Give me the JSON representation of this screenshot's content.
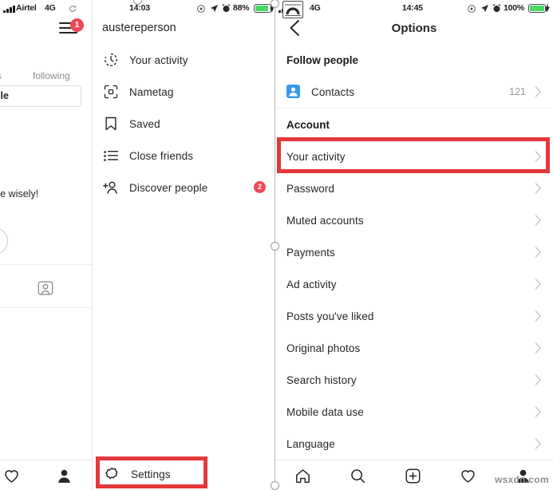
{
  "left_panel": {
    "status": {
      "carrier": "Airtel",
      "network": "4G"
    },
    "menu_badge": "1",
    "following_tab": "following",
    "followers_tab_partial": "s",
    "edit_profile_partial": "ile",
    "bio_partial": "se wisely!"
  },
  "mid_panel": {
    "status": {
      "time": "14:03",
      "battery": "88%"
    },
    "username": "austereperson",
    "items": [
      {
        "label": "Your activity",
        "icon": "clock-icon"
      },
      {
        "label": "Nametag",
        "icon": "nametag-icon"
      },
      {
        "label": "Saved",
        "icon": "bookmark-icon"
      },
      {
        "label": "Close friends",
        "icon": "close-friends-icon"
      },
      {
        "label": "Discover people",
        "icon": "discover-people-icon",
        "badge": "2"
      }
    ],
    "settings": {
      "label": "Settings",
      "icon": "gear-icon",
      "highlighted": true
    }
  },
  "right_panel": {
    "status": {
      "network": "4G",
      "time": "14:45",
      "battery": "100%"
    },
    "title": "Options",
    "back_icon": "back-chevron-icon",
    "sections": [
      {
        "header": "Follow people",
        "items": [
          {
            "label": "Contacts",
            "value": "121",
            "icon": "contacts-icon"
          }
        ]
      },
      {
        "header": "Account",
        "items": [
          {
            "label": "Your activity",
            "highlighted": true
          },
          {
            "label": "Password"
          },
          {
            "label": "Muted accounts"
          },
          {
            "label": "Payments"
          },
          {
            "label": "Ad activity"
          },
          {
            "label": "Posts you've liked"
          },
          {
            "label": "Original photos"
          },
          {
            "label": "Search history"
          },
          {
            "label": "Mobile data use"
          },
          {
            "label": "Language"
          }
        ]
      }
    ],
    "bottom_nav": [
      "home-icon",
      "search-icon",
      "add-post-icon",
      "activity-heart-icon",
      "profile-icon"
    ]
  },
  "watermark": "wsxdn.com",
  "colors": {
    "highlight": "#e5383b",
    "badge": "#ed4956",
    "contacts_blue": "#3897f0",
    "battery": "#4cd964"
  }
}
